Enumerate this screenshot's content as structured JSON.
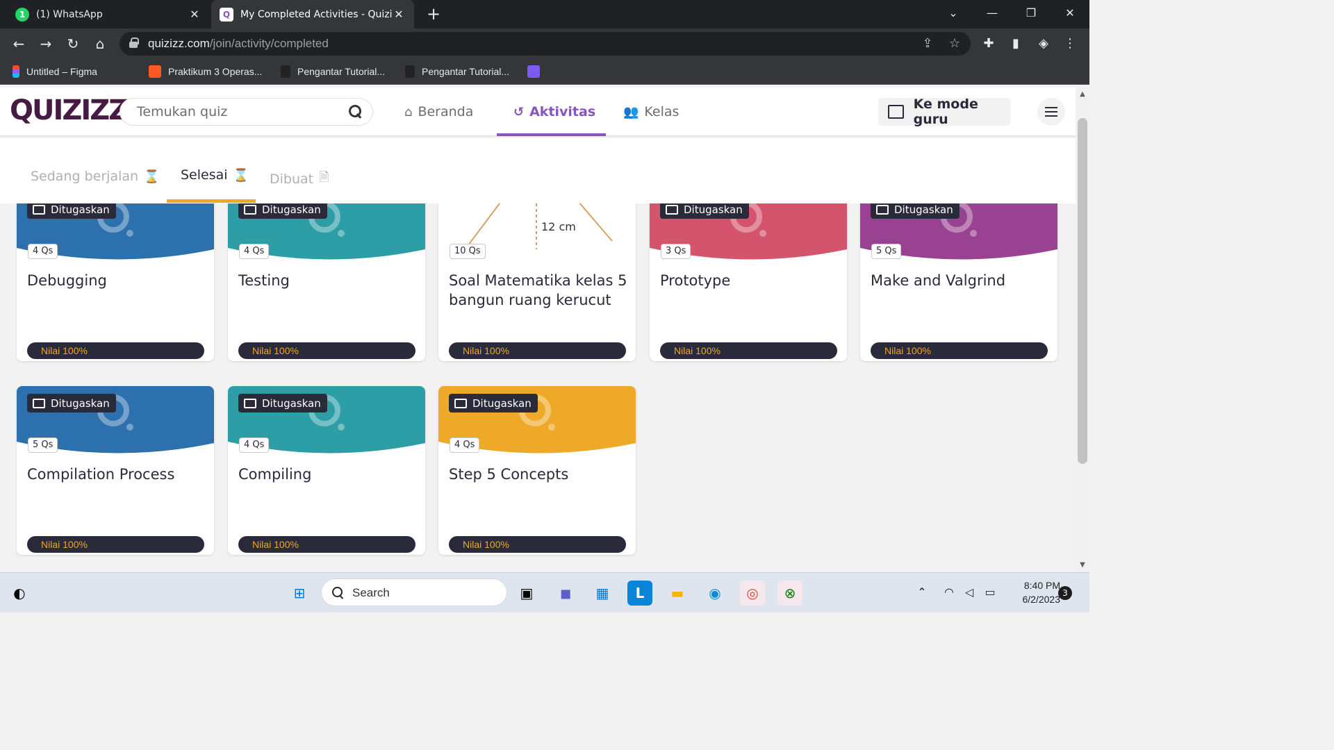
{
  "browser": {
    "tabs": [
      {
        "title": "(1) WhatsApp",
        "icon": "whatsapp-icon"
      },
      {
        "title": "My Completed Activities - Quizizz",
        "icon": "quizizz-icon"
      }
    ],
    "url_host": "quizizz.com",
    "url_path": "/join/activity/completed",
    "bookmarks": [
      {
        "label": "Untitled – Figma",
        "icon": "figma-icon"
      },
      {
        "label": "Praktikum 3 Operas...",
        "icon": "blogger-icon"
      },
      {
        "label": "Pengantar Tutorial...",
        "icon": "doc-icon"
      },
      {
        "label": "Pengantar Tutorial...",
        "icon": "doc-icon"
      }
    ]
  },
  "header": {
    "logo": "QUIZIZZ",
    "search_placeholder": "Temukan quiz",
    "nav": [
      {
        "label": "Beranda",
        "icon": "home-icon"
      },
      {
        "label": "Aktivitas",
        "icon": "history-icon",
        "active": true
      },
      {
        "label": "Kelas",
        "icon": "users-icon"
      }
    ],
    "teacher_mode": "Ke mode guru"
  },
  "subtabs": [
    {
      "label": "Sedang berjalan",
      "icon": "hourglass-icon"
    },
    {
      "label": "Selesai",
      "icon": "hourglass-icon",
      "active": true
    },
    {
      "label": "Dibuat",
      "icon": "document-icon"
    }
  ],
  "cards": [
    {
      "assigned": "Ditugaskan",
      "qs": "4 Qs",
      "title": "Debugging",
      "score": "Nilai 100%",
      "color": "#2d70ae"
    },
    {
      "assigned": "Ditugaskan",
      "qs": "4 Qs",
      "title": "Testing",
      "score": "Nilai 100%",
      "color": "#2d9da6"
    },
    {
      "assigned": "",
      "qs": "10 Qs",
      "title": "Soal Matematika kelas 5 bangun ruang kerucut",
      "score": "Nilai 100%",
      "color": "#ffffff",
      "image_label": "12 cm"
    },
    {
      "assigned": "Ditugaskan",
      "qs": "3 Qs",
      "title": "Prototype",
      "score": "Nilai 100%",
      "color": "#d5546d"
    },
    {
      "assigned": "Ditugaskan",
      "qs": "5 Qs",
      "title": "Make and Valgrind",
      "score": "Nilai 100%",
      "color": "#9a4292"
    },
    {
      "assigned": "Ditugaskan",
      "qs": "5 Qs",
      "title": "Compilation Process",
      "score": "Nilai 100%",
      "color": "#2d70ae"
    },
    {
      "assigned": "Ditugaskan",
      "qs": "4 Qs",
      "title": "Compiling",
      "score": "Nilai 100%",
      "color": "#2d9da6"
    },
    {
      "assigned": "Ditugaskan",
      "qs": "4 Qs",
      "title": "Step 5 Concepts",
      "score": "Nilai 100%",
      "color": "#efa929"
    }
  ],
  "taskbar": {
    "search_label": "Search",
    "time": "8:40 PM",
    "date": "6/2/2023",
    "notifications": "3"
  }
}
